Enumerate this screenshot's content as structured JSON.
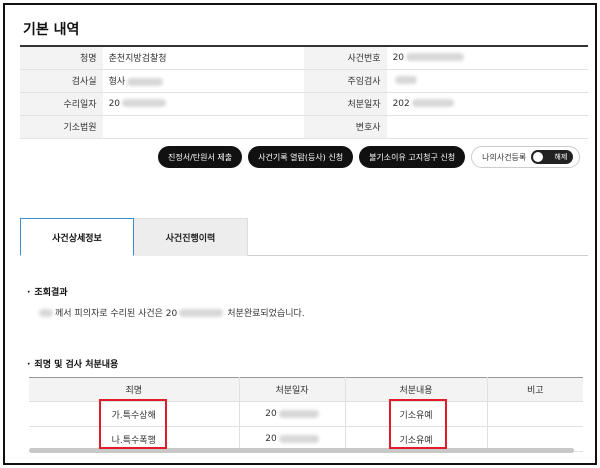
{
  "header": {
    "title": "기본 내역"
  },
  "info_table": {
    "rows": [
      {
        "l1": "청명",
        "v1": "춘천지방검찰청",
        "l2": "사건번호",
        "v2": "20"
      },
      {
        "l1": "검사실",
        "v1": "형사",
        "l2": "주임검사",
        "v2": ""
      },
      {
        "l1": "수리일자",
        "v1": "20",
        "l2": "처분일자",
        "v2": "202"
      },
      {
        "l1": "기소법원",
        "v1": "",
        "l2": "변호사",
        "v2": ""
      }
    ]
  },
  "actions": {
    "submit_label": "진정서/탄원서 제출",
    "records_label": "사건기록 열람(등사) 신청",
    "appeal_label": "불기소이유 고지청구 신청",
    "register_label": "나의사건등록",
    "toggle_label": "해제"
  },
  "tabs": {
    "detail": "사건상세정보",
    "history": "사건진행이력"
  },
  "inquiry": {
    "title": "조회결과",
    "text_prefix": "께서 피의자로 수리된 사건은 20",
    "text_suffix": "처분완료되었습니다."
  },
  "disposition": {
    "title": "죄명 및 검사 처분내용",
    "headers": [
      "죄명",
      "처분일자",
      "처분내용",
      "비고"
    ],
    "rows": [
      {
        "charge": "가.특수상해",
        "date": "20",
        "result": "기소유예",
        "note": ""
      },
      {
        "charge": "나.특수폭행",
        "date": "20",
        "result": "기소유예",
        "note": ""
      }
    ]
  },
  "colors": {
    "highlight_box": "#e21b2b",
    "active_tab_border": "#3a8ecf",
    "button_bg": "#111111"
  }
}
